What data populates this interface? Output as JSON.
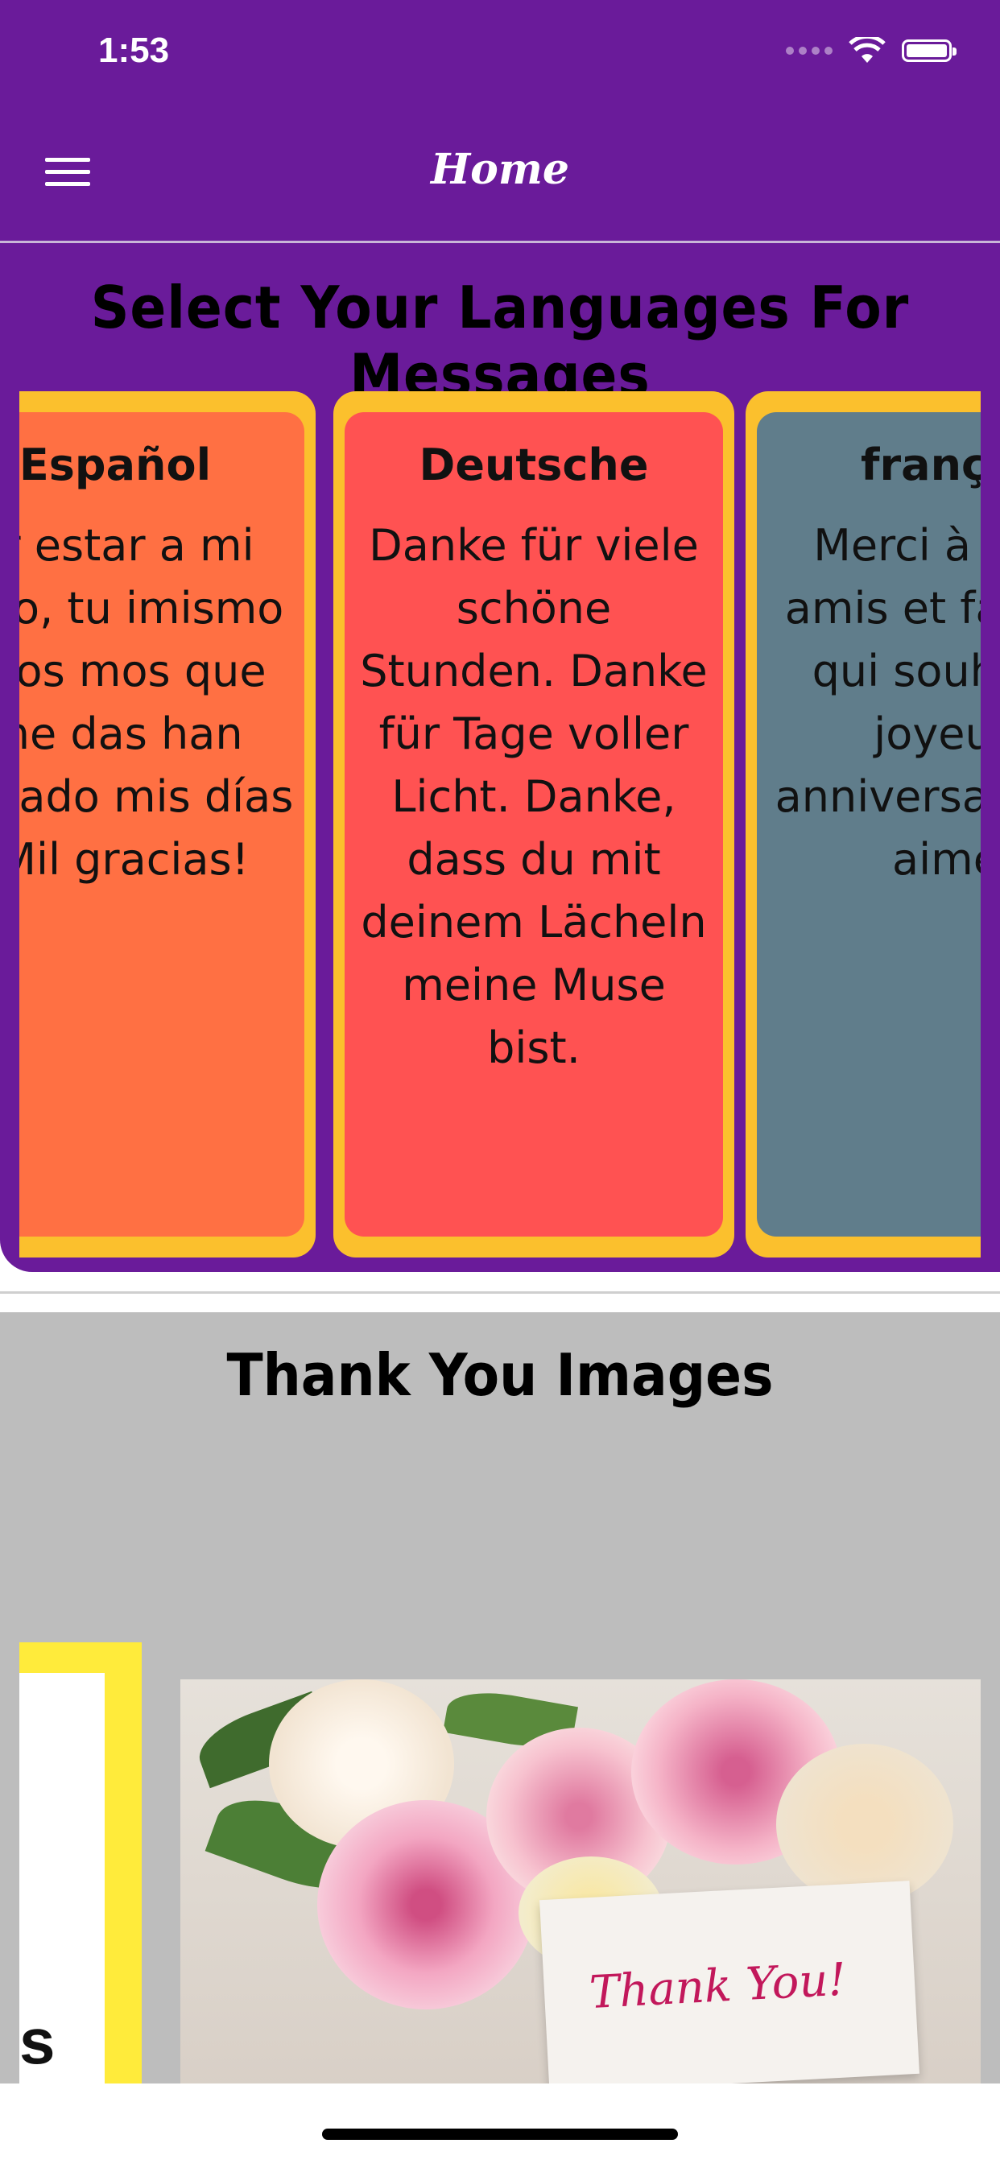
{
  "status_bar": {
    "time": "1:53"
  },
  "nav": {
    "title": "Home"
  },
  "languages": {
    "heading": "Select Your Languages For Messages",
    "cards": [
      {
        "title": "Español",
        "text": "or estar a mi lado, tu imismo y los mos que me das han minado mis días ¡Mil gracias!",
        "color": "#ff7043"
      },
      {
        "title": "Deutsche",
        "text": "Danke für viele schöne Stunden. Danke für Tage voller Licht. Danke, dass du mit deinem Lächeln meine Muse bist.",
        "color": "#ff5252"
      },
      {
        "title": "françai",
        "text": "Merci à tous amis et famille qui souhaité joyeux anniversai vous aime",
        "color": "#607d8b"
      }
    ]
  },
  "images": {
    "heading": "Thank You Images",
    "left_card_letter": "s",
    "photo_tag": "Thank You!"
  }
}
